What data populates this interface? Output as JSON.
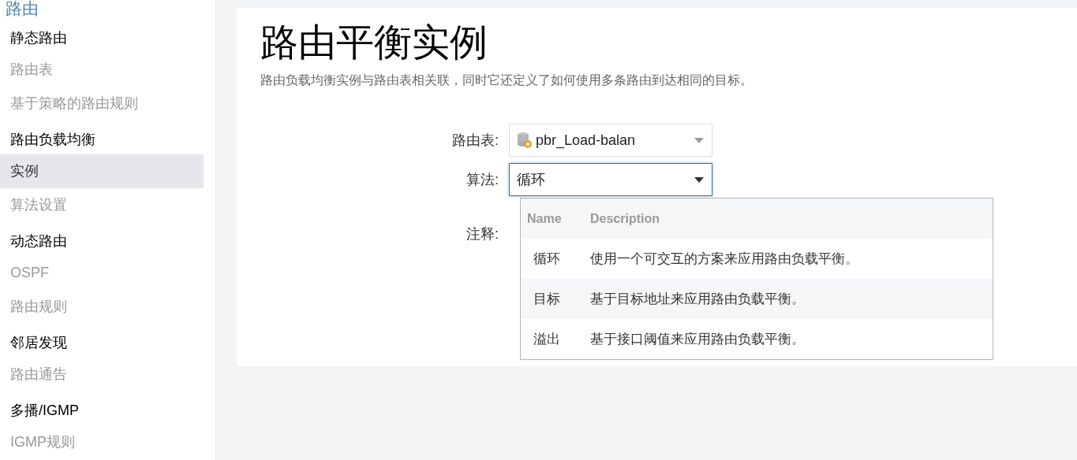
{
  "sidebar": {
    "title": "路由",
    "groups": [
      {
        "label": "静态路由",
        "items": [
          {
            "label": "路由表",
            "selected": false
          },
          {
            "label": "基于策略的路由规则",
            "selected": false
          }
        ]
      },
      {
        "label": "路由负载均衡",
        "items": [
          {
            "label": "实例",
            "selected": true
          },
          {
            "label": "算法设置",
            "selected": false
          }
        ]
      },
      {
        "label": "动态路由",
        "items": [
          {
            "label": "OSPF",
            "selected": false
          },
          {
            "label": "路由规则",
            "selected": false
          }
        ]
      },
      {
        "label": "邻居发现",
        "items": [
          {
            "label": "路由通告",
            "selected": false
          }
        ]
      },
      {
        "label": "多播/IGMP",
        "items": [
          {
            "label": "IGMP规则",
            "selected": false
          }
        ]
      }
    ]
  },
  "page": {
    "title": "路由平衡实例",
    "description": "路由负载均衡实例与路由表相关联，同时它还定义了如何使用多条路由到达相同的目标。",
    "fields": [
      {
        "label": "路由表:",
        "value": "pbr_Load-balan",
        "focused": false,
        "icon": true
      },
      {
        "label": "算法:",
        "value": "循环",
        "focused": true,
        "icon": false
      },
      {
        "label": "注释:"
      }
    ],
    "dropdown": {
      "columns": [
        "Name",
        "Description"
      ],
      "rows": [
        {
          "name": "循环",
          "description": "使用一个可交互的方案来应用路由负载平衡。"
        },
        {
          "name": "目标",
          "description": "基于目标地址来应用路由负载平衡。"
        },
        {
          "name": "溢出",
          "description": "基于接口阈值来应用路由负载平衡。"
        }
      ]
    }
  }
}
